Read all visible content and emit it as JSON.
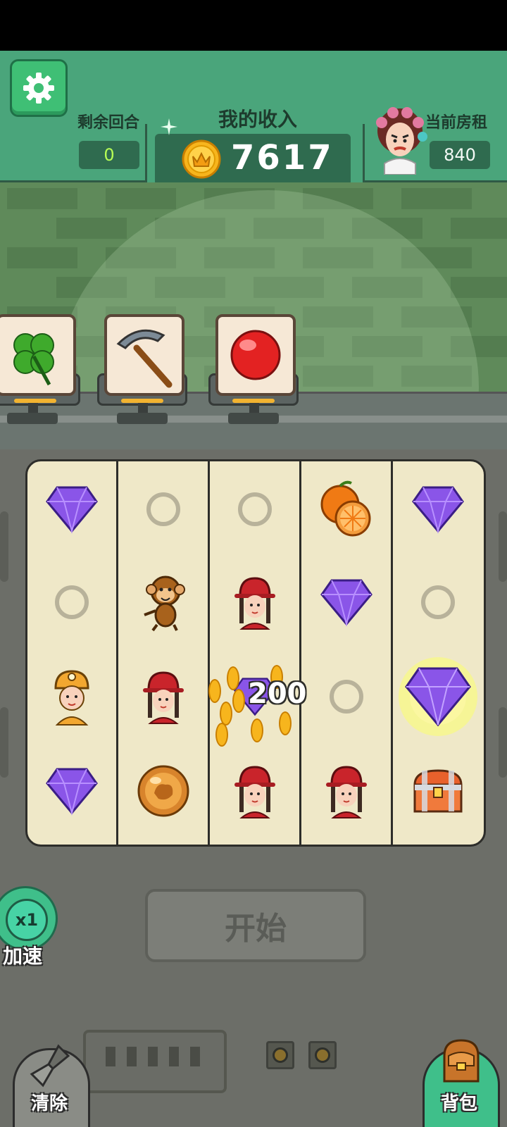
{
  "hud": {
    "rounds_label": "剩余回合",
    "rounds_value": "0",
    "income_label": "我的收入",
    "income_value": "7617",
    "rent_label": "当前房租",
    "rent_value": "840"
  },
  "item_shelf": [
    {
      "name": "four-leaf-clover"
    },
    {
      "name": "pickaxe"
    },
    {
      "name": "red-orb"
    }
  ],
  "board": {
    "columns": 5,
    "rows": 4,
    "cells": [
      [
        "purple-gem",
        "empty",
        "empty",
        "orange",
        "purple-gem"
      ],
      [
        "empty",
        "monkey",
        "red-hat-girl",
        "purple-gem",
        "empty"
      ],
      [
        "miner",
        "red-hat-girl",
        "purple-gem",
        "empty",
        "purple-gem-glowing"
      ],
      [
        "purple-gem",
        "amber-orb",
        "red-hat-girl",
        "red-hat-girl",
        "treasure-chest"
      ]
    ]
  },
  "bonus_popup": "200",
  "buttons": {
    "start": "开始",
    "speed_multiplier": "x1",
    "speed_label": "加速",
    "clear_label": "清除",
    "bag_label": "背包"
  },
  "colors": {
    "header_green": "#4aa57b",
    "value_box": "#2f6b4f",
    "rounds_text": "#b7ff55",
    "board_bg": "#efe8c8",
    "gem_purple": "#8a55e8",
    "coin_gold": "#f7b51d"
  }
}
